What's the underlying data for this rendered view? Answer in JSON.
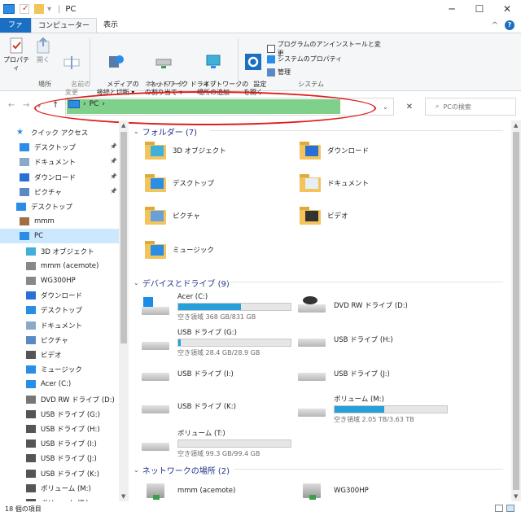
{
  "window": {
    "title": "PC",
    "controls": {
      "minimize": "─",
      "maximize": "☐",
      "close": "✕"
    }
  },
  "ribbon_tabs": [
    {
      "label": "ファイル"
    },
    {
      "label": "コンピューター"
    },
    {
      "label": "表示"
    }
  ],
  "help": {
    "collapse": "^",
    "help": "?"
  },
  "ribbon": {
    "groups": {
      "location": "場所",
      "network": "ネットワーク",
      "system": "システム"
    },
    "buttons": {
      "properties": "プロパティ",
      "open": "開く",
      "rename": "名前の\n変更",
      "media": "メディアの\n接続と切断 ▾",
      "map_drive": "ネットワーク ドライブ\nの割り当て ▾",
      "add_network": "ネットワークの\n場所の追加",
      "settings": "設定\nを開く",
      "uninstall": "プログラムのアンインストールと変更",
      "system_props": "システムのプロパティ",
      "manage": "管理"
    }
  },
  "address": {
    "up_arrow": "↑",
    "path": "PC",
    "chevron": "›",
    "search_placeholder": "PCの検索"
  },
  "nav": {
    "items": [
      {
        "label": "クイック アクセス",
        "icon": "star-icon",
        "color": "#2a8ee6"
      },
      {
        "label": "デスクトップ",
        "icon": "desktop-icon",
        "color": "#2a8ee6",
        "pinned": true
      },
      {
        "label": "ドキュメント",
        "icon": "document-icon",
        "color": "#8aa8c8",
        "pinned": true
      },
      {
        "label": "ダウンロード",
        "icon": "download-icon",
        "color": "#2a6fd6",
        "pinned": true
      },
      {
        "label": "ピクチャ",
        "icon": "pictures-icon",
        "color": "#5a8ac6",
        "pinned": true
      },
      {
        "label": "デスクトップ",
        "icon": "desktop-icon",
        "color": "#2a8ee6"
      },
      {
        "label": "mmm",
        "icon": "user-icon",
        "color": "#a07040"
      },
      {
        "label": "PC",
        "icon": "pc-icon",
        "color": "#2a8ee6",
        "selected": true
      },
      {
        "label": "3D オブジェクト",
        "icon": "3d-objects-icon",
        "color": "#3fb0d8"
      },
      {
        "label": "mmm (acemote)",
        "icon": "network-pc-icon",
        "color": "#888888"
      },
      {
        "label": "WG300HP",
        "icon": "network-device-icon",
        "color": "#888888"
      },
      {
        "label": "ダウンロード",
        "icon": "download-icon",
        "color": "#2a6fd6"
      },
      {
        "label": "デスクトップ",
        "icon": "desktop-icon",
        "color": "#2a8ee6"
      },
      {
        "label": "ドキュメント",
        "icon": "document-icon",
        "color": "#8aa8c8"
      },
      {
        "label": "ピクチャ",
        "icon": "pictures-icon",
        "color": "#5a8ac6"
      },
      {
        "label": "ビデオ",
        "icon": "video-icon",
        "color": "#555555"
      },
      {
        "label": "ミュージック",
        "icon": "music-icon",
        "color": "#2a8ee6"
      },
      {
        "label": "Acer (C:)",
        "icon": "windows-drive-icon",
        "color": "#2a8ee6"
      },
      {
        "label": "DVD RW ドライブ (D:)",
        "icon": "dvd-drive-icon",
        "color": "#777777"
      },
      {
        "label": "USB ドライブ (G:)",
        "icon": "usb-drive-icon",
        "color": "#555555"
      },
      {
        "label": "USB ドライブ (H:)",
        "icon": "usb-drive-icon",
        "color": "#555555"
      },
      {
        "label": "USB ドライブ (I:)",
        "icon": "usb-drive-icon",
        "color": "#555555"
      },
      {
        "label": "USB ドライブ (J:)",
        "icon": "usb-drive-icon",
        "color": "#555555"
      },
      {
        "label": "USB ドライブ (K:)",
        "icon": "usb-drive-icon",
        "color": "#555555"
      },
      {
        "label": "ボリューム (M:)",
        "icon": "drive-icon",
        "color": "#555555"
      },
      {
        "label": "ボリューム (T:)",
        "icon": "drive-icon",
        "color": "#555555"
      }
    ]
  },
  "sections": {
    "folders": "フォルダー (7)",
    "devices": "デバイスとドライブ (9)",
    "network": "ネットワークの場所 (2)"
  },
  "folders": [
    {
      "label": "3D オブジェクト",
      "overlay": "3d-objects"
    },
    {
      "label": "ダウンロード",
      "overlay": "download"
    },
    {
      "label": "デスクトップ",
      "overlay": "desktop"
    },
    {
      "label": "ドキュメント",
      "overlay": "document"
    },
    {
      "label": "ピクチャ",
      "overlay": "pictures"
    },
    {
      "label": "ビデオ",
      "overlay": "video"
    },
    {
      "label": "ミュージック",
      "overlay": "music"
    }
  ],
  "drives": [
    {
      "label": "Acer (C:)",
      "free": "空き領域 368 GB/831 GB",
      "used_fraction": 0.56,
      "kind": "windows"
    },
    {
      "label": "DVD RW ドライブ (D:)",
      "free": "",
      "kind": "dvd"
    },
    {
      "label": "USB ドライブ (G:)",
      "free": "空き領域 28.4 GB/28.9 GB",
      "used_fraction": 0.02,
      "kind": "usb"
    },
    {
      "label": "USB ドライブ (H:)",
      "free": "",
      "kind": "usb"
    },
    {
      "label": "USB ドライブ (I:)",
      "free": "",
      "kind": "usb"
    },
    {
      "label": "USB ドライブ (J:)",
      "free": "",
      "kind": "usb"
    },
    {
      "label": "USB ドライブ (K:)",
      "free": "",
      "kind": "usb"
    },
    {
      "label": "ボリューム (M:)",
      "free": "空き領域 2.05 TB/3.63 TB",
      "used_fraction": 0.44,
      "kind": "hdd"
    },
    {
      "label": "ボリューム (T:)",
      "free": "空き領域 99.3 GB/99.4 GB",
      "used_fraction": 0.0,
      "kind": "hdd"
    }
  ],
  "network_locations": [
    {
      "label": "mmm (acemote)"
    },
    {
      "label": "WG300HP"
    }
  ],
  "status": {
    "items": "18 個の項目"
  },
  "colors": {
    "accent": "#1a6fc2",
    "selection": "#cce8ff",
    "address_highlight": "#7ed08a",
    "annotation": "#e01d1d",
    "bar_fill": "#26a0da"
  }
}
